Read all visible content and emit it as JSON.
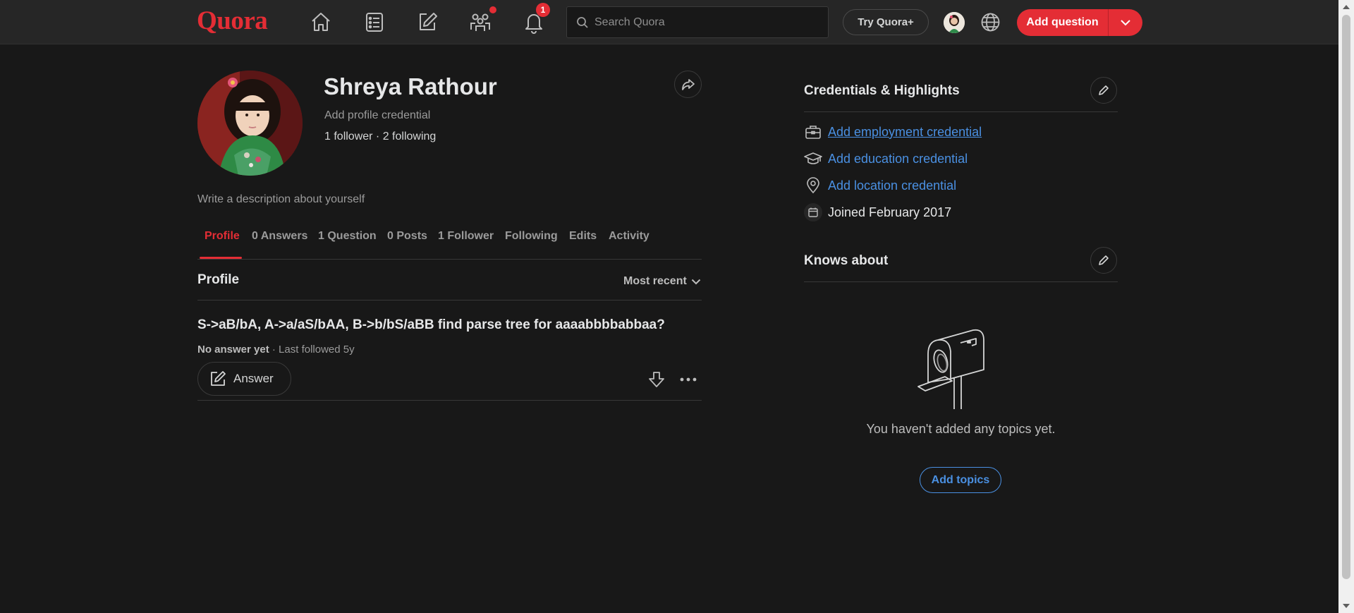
{
  "nav": {
    "logo": "Quora",
    "icons": [
      "home-icon",
      "following-icon",
      "answer-icon",
      "spaces-icon",
      "notifications-icon"
    ],
    "notification_count": "1",
    "search_placeholder": "Search Quora",
    "try_button": "Try Quora+",
    "add_question": "Add question"
  },
  "profile": {
    "name": "Shreya Rathour",
    "add_credential": "Add profile credential",
    "followers": "1 follower · 2 following",
    "description": "Write a description about yourself"
  },
  "tabs": [
    {
      "label": "Profile",
      "active": true
    },
    {
      "label": "0 Answers"
    },
    {
      "label": "1 Question"
    },
    {
      "label": "0 Posts"
    },
    {
      "label": "1 Follower"
    },
    {
      "label": "Following"
    },
    {
      "label": "Edits"
    },
    {
      "label": "Activity"
    }
  ],
  "feed": {
    "section_title": "Profile",
    "sort": "Most recent",
    "question": {
      "title": "S->aB/bA, A->a/aS/bAA, B->b/bS/aBB find parse tree for aaaabbbbabbaa?",
      "status": "No answer yet",
      "meta": " · Last followed 5y",
      "answer_button": "Answer"
    }
  },
  "credentials": {
    "title": "Credentials & Highlights",
    "items": [
      {
        "icon": "briefcase-icon",
        "label": "Add employment credential"
      },
      {
        "icon": "graduation-cap-icon",
        "label": "Add education credential"
      },
      {
        "icon": "location-pin-icon",
        "label": "Add location credential"
      },
      {
        "icon": "calendar-icon",
        "label": "Joined February 2017"
      }
    ]
  },
  "knows_about": {
    "title": "Knows about",
    "empty_text": "You haven't added any topics yet.",
    "button": "Add topics"
  },
  "colors": {
    "brand": "#e42d35",
    "link": "#4a90e2",
    "background": "#181818",
    "nav_background": "#262626"
  }
}
